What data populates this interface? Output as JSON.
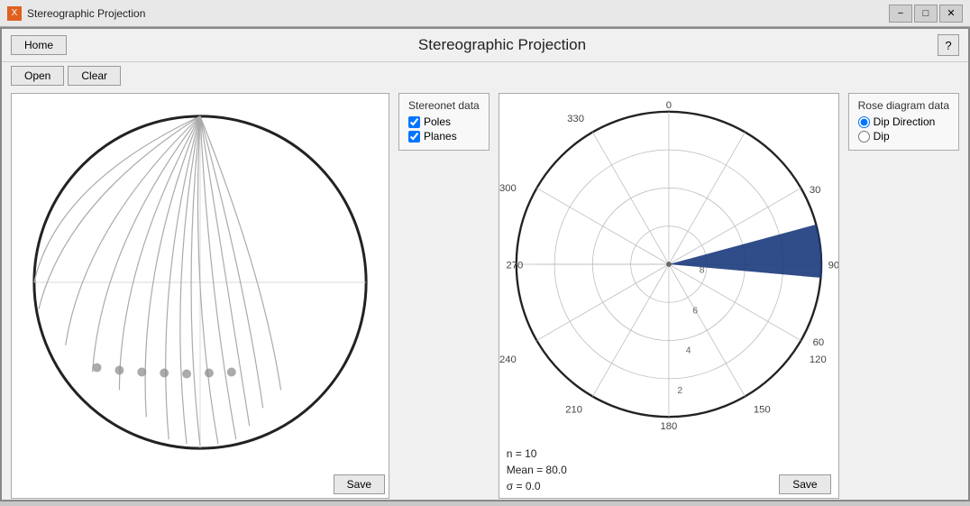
{
  "titleBar": {
    "icon": "X",
    "title": "Stereographic Projection",
    "minimize": "−",
    "maximize": "□",
    "close": "✕"
  },
  "header": {
    "homeLabel": "Home",
    "title": "Stereographic Projection",
    "helpLabel": "?"
  },
  "toolbar": {
    "openLabel": "Open",
    "clearLabel": "Clear"
  },
  "stereonetData": {
    "boxTitle": "Stereonet data",
    "polesLabel": "Poles",
    "planesLabel": "Planes",
    "polesChecked": true,
    "planesChecked": true,
    "saveLabel": "Save"
  },
  "roseDiagramData": {
    "boxTitle": "Rose diagram data",
    "dipDirectionLabel": "Dip Direction",
    "dipLabel": "Dip",
    "dipDirectionSelected": true,
    "saveLabel": "Save"
  },
  "stats": {
    "n": "n = 10",
    "mean": "Mean = 80.0",
    "sigma": "σ = 0.0"
  },
  "roseChart": {
    "labels": [
      "0",
      "30",
      "60",
      "90",
      "120",
      "150",
      "180",
      "210",
      "240",
      "270",
      "300",
      "330"
    ],
    "rings": [
      2,
      4,
      6,
      8
    ],
    "segment": {
      "startAngle": 75,
      "endAngle": 95,
      "radius": 8,
      "color": "#1a3a7c"
    }
  }
}
